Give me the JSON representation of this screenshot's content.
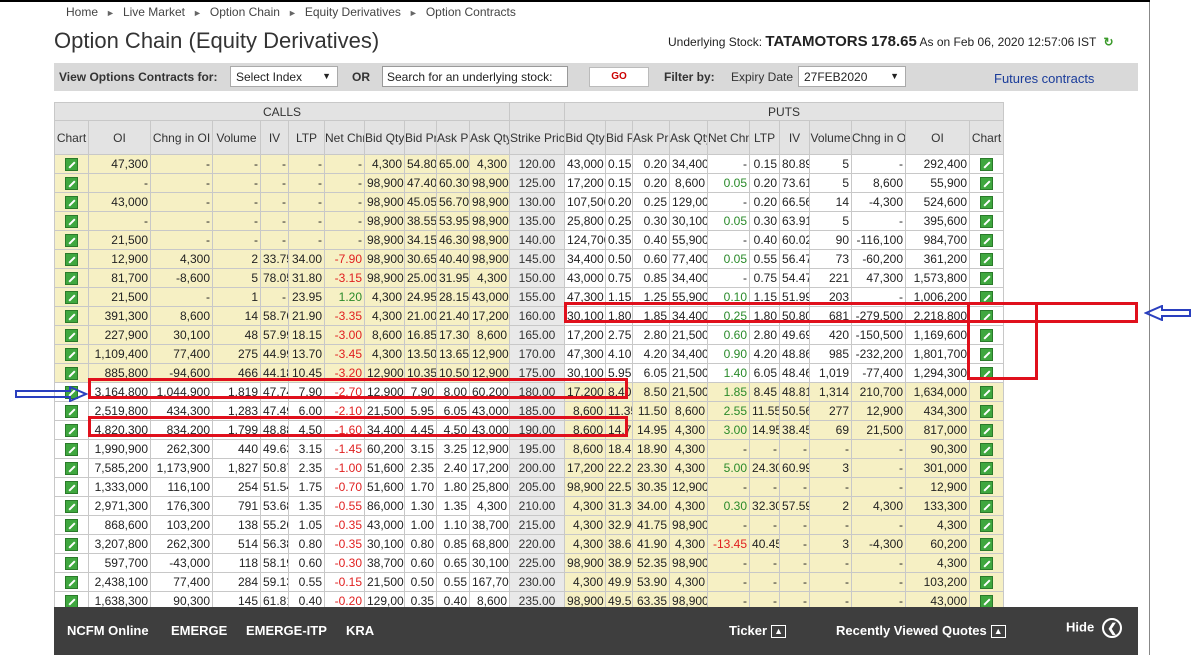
{
  "breadcrumb": [
    "Home",
    "Live Market",
    "Option Chain",
    "Equity Derivatives",
    "Option Contracts"
  ],
  "title": "Option Chain (Equity Derivatives)",
  "underlying": {
    "label": "Underlying Stock:",
    "symbol": "TATAMOTORS",
    "price": "178.65",
    "asof": "As on Feb 06, 2020 12:57:06 IST"
  },
  "filters": {
    "view_label": "View Options Contracts for:",
    "select_index": "Select Index",
    "or_label": "OR",
    "search_value": "Search for an underlying stock:",
    "go_label": "GO",
    "filter_label": "Filter by:",
    "expiry_label": "Expiry Date",
    "expiry_value": "27FEB2020",
    "futures_link": "Futures contracts"
  },
  "table": {
    "calls_label": "CALLS",
    "puts_label": "PUTS",
    "call_headers": [
      "Chart",
      "OI",
      "Chng in OI",
      "Volume",
      "IV",
      "LTP",
      "Net Chng",
      "Bid Qty",
      "Bid Price",
      "Ask Price",
      "Ask Qty"
    ],
    "strike_header": "Strike Price",
    "put_headers": [
      "Bid Qty",
      "Bid Price",
      "Ask Price",
      "Ask Qty",
      "Net Chng",
      "LTP",
      "IV",
      "Volume",
      "Chng in OI",
      "OI",
      "Chart"
    ],
    "rows": [
      {
        "c": [
          "47,300",
          "-",
          "-",
          "-",
          "-",
          "-",
          "4,300",
          "54.80",
          "65.00",
          "4,300"
        ],
        "k": "120.00",
        "p": [
          "43,000",
          "0.15",
          "0.20",
          "34,400",
          "-",
          "0.15",
          "80.89",
          "5",
          "-",
          "292,400"
        ]
      },
      {
        "c": [
          "-",
          "-",
          "-",
          "-",
          "-",
          "-",
          "98,900",
          "47.40",
          "60.30",
          "98,900"
        ],
        "k": "125.00",
        "p": [
          "17,200",
          "0.15",
          "0.20",
          "8,600",
          "0.05",
          "0.20",
          "73.61",
          "5",
          "8,600",
          "55,900"
        ]
      },
      {
        "c": [
          "43,000",
          "-",
          "-",
          "-",
          "-",
          "-",
          "98,900",
          "45.05",
          "56.70",
          "98,900"
        ],
        "k": "130.00",
        "p": [
          "107,500",
          "0.20",
          "0.25",
          "129,000",
          "-",
          "0.20",
          "66.56",
          "14",
          "-4,300",
          "524,600"
        ]
      },
      {
        "c": [
          "-",
          "-",
          "-",
          "-",
          "-",
          "-",
          "98,900",
          "38.55",
          "53.95",
          "98,900"
        ],
        "k": "135.00",
        "p": [
          "25,800",
          "0.25",
          "0.30",
          "30,100",
          "0.05",
          "0.30",
          "63.91",
          "5",
          "-",
          "395,600"
        ]
      },
      {
        "c": [
          "21,500",
          "-",
          "-",
          "-",
          "-",
          "-",
          "98,900",
          "34.15",
          "46.30",
          "98,900"
        ],
        "k": "140.00",
        "p": [
          "124,700",
          "0.35",
          "0.40",
          "55,900",
          "-",
          "0.40",
          "60.02",
          "90",
          "-116,100",
          "984,700"
        ]
      },
      {
        "c": [
          "12,900",
          "4,300",
          "2",
          "33.75",
          "34.00",
          "-7.90",
          "98,900",
          "30.65",
          "40.40",
          "98,900"
        ],
        "k": "145.00",
        "p": [
          "34,400",
          "0.50",
          "0.60",
          "77,400",
          "0.05",
          "0.55",
          "56.47",
          "73",
          "-60,200",
          "361,200"
        ]
      },
      {
        "c": [
          "81,700",
          "-8,600",
          "5",
          "78.05",
          "31.80",
          "-3.15",
          "98,900",
          "25.00",
          "31.95",
          "4,300"
        ],
        "k": "150.00",
        "p": [
          "43,000",
          "0.75",
          "0.85",
          "34,400",
          "-",
          "0.75",
          "54.47",
          "221",
          "47,300",
          "1,573,800"
        ]
      },
      {
        "c": [
          "21,500",
          "-",
          "1",
          "-",
          "23.95",
          "1.20",
          "4,300",
          "24.95",
          "28.15",
          "43,000"
        ],
        "k": "155.00",
        "p": [
          "47,300",
          "1.15",
          "1.25",
          "55,900",
          "0.10",
          "1.15",
          "51.99",
          "203",
          "-",
          "1,006,200"
        ]
      },
      {
        "c": [
          "391,300",
          "8,600",
          "14",
          "58.76",
          "21.90",
          "-3.35",
          "4,300",
          "21.00",
          "21.40",
          "17,200"
        ],
        "k": "160.00",
        "p": [
          "30,100",
          "1.80",
          "1.85",
          "34,400",
          "0.25",
          "1.80",
          "50.80",
          "681",
          "-279,500",
          "2,218,800"
        ]
      },
      {
        "c": [
          "227,900",
          "30,100",
          "48",
          "57.99",
          "18.15",
          "-3.00",
          "8,600",
          "16.85",
          "17.30",
          "8,600"
        ],
        "k": "165.00",
        "p": [
          "17,200",
          "2.75",
          "2.80",
          "21,500",
          "0.60",
          "2.80",
          "49.69",
          "420",
          "-150,500",
          "1,169,600"
        ]
      },
      {
        "c": [
          "1,109,400",
          "77,400",
          "275",
          "44.99",
          "13.70",
          "-3.45",
          "4,300",
          "13.50",
          "13.65",
          "12,900"
        ],
        "k": "170.00",
        "p": [
          "47,300",
          "4.10",
          "4.20",
          "34,400",
          "0.90",
          "4.20",
          "48.86",
          "985",
          "-232,200",
          "1,801,700"
        ]
      },
      {
        "c": [
          "885,800",
          "-94,600",
          "466",
          "44.18",
          "10.45",
          "-3.20",
          "12,900",
          "10.35",
          "10.50",
          "12,900"
        ],
        "k": "175.00",
        "p": [
          "30,100",
          "5.95",
          "6.05",
          "21,500",
          "1.40",
          "6.05",
          "48.46",
          "1,019",
          "-77,400",
          "1,294,300"
        ]
      },
      {
        "c": [
          "3,164,800",
          "1,044,900",
          "1,819",
          "47.74",
          "7.90",
          "-2.70",
          "12,900",
          "7.90",
          "8.00",
          "60,200"
        ],
        "k": "180.00",
        "p": [
          "17,200",
          "8.40",
          "8.50",
          "21,500",
          "1.85",
          "8.45",
          "48.81",
          "1,314",
          "210,700",
          "1,634,000"
        ]
      },
      {
        "c": [
          "2,519,800",
          "434,300",
          "1,283",
          "47.49",
          "6.00",
          "-2.10",
          "21,500",
          "5.95",
          "6.05",
          "43,000"
        ],
        "k": "185.00",
        "p": [
          "8,600",
          "11.35",
          "11.50",
          "8,600",
          "2.55",
          "11.55",
          "50.56",
          "277",
          "12,900",
          "434,300"
        ]
      },
      {
        "c": [
          "4,820,300",
          "834,200",
          "1,799",
          "48.88",
          "4.50",
          "-1.60",
          "34,400",
          "4.45",
          "4.50",
          "43,000"
        ],
        "k": "190.00",
        "p": [
          "8,600",
          "14.75",
          "14.95",
          "4,300",
          "3.00",
          "14.95",
          "38.45",
          "69",
          "21,500",
          "817,000"
        ]
      },
      {
        "c": [
          "1,990,900",
          "262,300",
          "440",
          "49.63",
          "3.15",
          "-1.45",
          "60,200",
          "3.15",
          "3.25",
          "12,900"
        ],
        "k": "195.00",
        "p": [
          "8,600",
          "18.45",
          "18.90",
          "4,300",
          "-",
          "-",
          "-",
          "-",
          "-",
          "90,300"
        ]
      },
      {
        "c": [
          "7,585,200",
          "1,173,900",
          "1,827",
          "50.87",
          "2.35",
          "-1.00",
          "51,600",
          "2.35",
          "2.40",
          "17,200"
        ],
        "k": "200.00",
        "p": [
          "17,200",
          "22.25",
          "23.30",
          "4,300",
          "5.00",
          "24.30",
          "60.99",
          "3",
          "-",
          "301,000"
        ]
      },
      {
        "c": [
          "1,333,000",
          "116,100",
          "254",
          "51.54",
          "1.75",
          "-0.70",
          "51,600",
          "1.70",
          "1.80",
          "25,800"
        ],
        "k": "205.00",
        "p": [
          "98,900",
          "22.55",
          "30.35",
          "12,900",
          "-",
          "-",
          "-",
          "-",
          "-",
          "12,900"
        ]
      },
      {
        "c": [
          "2,971,300",
          "176,300",
          "791",
          "53.68",
          "1.35",
          "-0.55",
          "86,000",
          "1.30",
          "1.35",
          "4,300"
        ],
        "k": "210.00",
        "p": [
          "4,300",
          "31.30",
          "34.00",
          "4,300",
          "0.30",
          "32.30",
          "57.59",
          "2",
          "4,300",
          "133,300"
        ]
      },
      {
        "c": [
          "868,600",
          "103,200",
          "138",
          "55.26",
          "1.05",
          "-0.35",
          "43,000",
          "1.00",
          "1.10",
          "38,700"
        ],
        "k": "215.00",
        "p": [
          "4,300",
          "32.90",
          "41.75",
          "98,900",
          "-",
          "-",
          "-",
          "-",
          "-",
          "4,300"
        ]
      },
      {
        "c": [
          "3,207,800",
          "262,300",
          "514",
          "56.38",
          "0.80",
          "-0.35",
          "30,100",
          "0.80",
          "0.85",
          "68,800"
        ],
        "k": "220.00",
        "p": [
          "4,300",
          "38.65",
          "41.90",
          "4,300",
          "-13.45",
          "40.45",
          "-",
          "3",
          "-4,300",
          "60,200"
        ]
      },
      {
        "c": [
          "597,700",
          "-43,000",
          "118",
          "58.19",
          "0.60",
          "-0.30",
          "38,700",
          "0.60",
          "0.65",
          "30,100"
        ],
        "k": "225.00",
        "p": [
          "98,900",
          "38.90",
          "52.35",
          "98,900",
          "-",
          "-",
          "-",
          "-",
          "-",
          "4,300"
        ]
      },
      {
        "c": [
          "2,438,100",
          "77,400",
          "284",
          "59.13",
          "0.55",
          "-0.15",
          "21,500",
          "0.50",
          "0.55",
          "167,700"
        ],
        "k": "230.00",
        "p": [
          "4,300",
          "49.95",
          "53.90",
          "4,300",
          "-",
          "-",
          "-",
          "-",
          "-",
          "103,200"
        ]
      },
      {
        "c": [
          "1,638,300",
          "90,300",
          "145",
          "61.81",
          "0.40",
          "-0.20",
          "129,000",
          "0.35",
          "0.40",
          "8,600"
        ],
        "k": "235.00",
        "p": [
          "98,900",
          "49.55",
          "63.35",
          "98,900",
          "-",
          "-",
          "-",
          "-",
          "-",
          "43,000"
        ]
      }
    ]
  },
  "footer": {
    "ncfm": "NCFM Online",
    "emerge": "EMERGE",
    "emerge_itp": "EMERGE-ITP",
    "kra": "KRA",
    "ticker": "Ticker",
    "recent": "Recently Viewed Quotes",
    "hide": "Hide"
  },
  "colors": {
    "itm_bg": "#f6f0c4",
    "header_bg": "#e3e3e3",
    "negative": "#e02020",
    "positive": "#2a8a2a",
    "highlight": "#e0101c",
    "arrow": "#2a3fbf",
    "footer_bg": "#3e3e3e"
  }
}
